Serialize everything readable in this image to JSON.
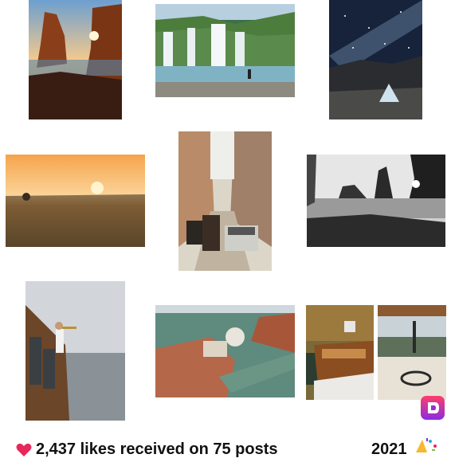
{
  "photos": [
    {
      "name": "photo-coastal-rocks-sunset",
      "subject": "coastal sea stacks at sunset"
    },
    {
      "name": "photo-waterfall",
      "subject": "waterfall with hiker"
    },
    {
      "name": "photo-milky-way-tent",
      "subject": "milky way over tent"
    },
    {
      "name": "photo-balloons-sunrise",
      "subject": "hot air balloons at sunrise"
    },
    {
      "name": "photo-street-vintage-car",
      "subject": "narrow street with vintage car and carriage"
    },
    {
      "name": "photo-bw-coastline",
      "subject": "black and white coastline"
    },
    {
      "name": "photo-boat-trumpet",
      "subject": "man playing trumpet on boat"
    },
    {
      "name": "photo-venice-aerial",
      "subject": "aerial view of Venice"
    },
    {
      "name": "photo-wooden-boat",
      "subject": "wooden boat"
    },
    {
      "name": "photo-boat-deck",
      "subject": "boat deck and steering wheel"
    }
  ],
  "footer": {
    "likes_text": "2,437 likes received on 75 posts",
    "year": "2021",
    "heart_icon": "heart-icon",
    "confetti_icon": "confetti-icon",
    "logo_icon": "app-logo-icon"
  },
  "colors": {
    "heart": "#e8285a",
    "logo_top": "#ff3e6c",
    "logo_bottom": "#8b2be2"
  }
}
